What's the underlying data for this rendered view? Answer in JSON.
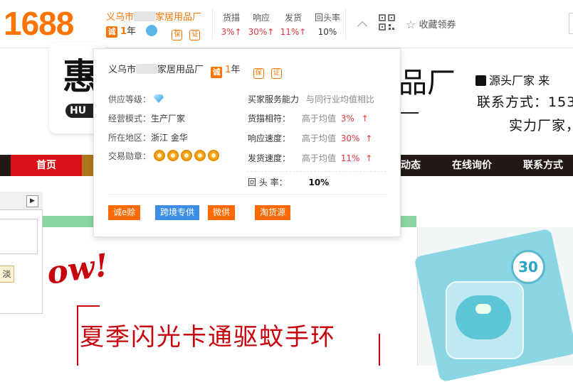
{
  "header": {
    "logo": "1688",
    "company_prefix": "义乌市",
    "company_suffix": "家居用品厂",
    "cheng_badge": "诚",
    "years": "1",
    "years_unit": "年",
    "metrics": [
      {
        "label": "货描",
        "value": "3%↑"
      },
      {
        "label": "响应",
        "value": "30%↑"
      },
      {
        "label": "发货",
        "value": "11%↑"
      },
      {
        "label": "回头率",
        "value": "10%"
      }
    ],
    "favorite_label": "收藏领券"
  },
  "banner": {
    "sign_char": "惠",
    "sign_pill": "HU",
    "sign_right": "品厂",
    "features": "源头厂家  来",
    "contact": "联系方式：153",
    "tagline": "实力厂家，"
  },
  "nav": {
    "home": "首页",
    "items": [
      "动态",
      "在线询价",
      "联系方式"
    ]
  },
  "content": {
    "wow_text": "ow!",
    "product_title": "夏季闪光卡通驱蚊手环",
    "badge_number": "30",
    "side_button": "淡"
  },
  "popup": {
    "company_prefix": "义乌市",
    "company_suffix": "家居用品厂",
    "cheng_badge": "诚",
    "years": "1",
    "years_unit": "年",
    "left": [
      {
        "label": "供应等级：",
        "value": ""
      },
      {
        "label": "经营模式：",
        "value": "生产厂家"
      },
      {
        "label": "所在地区：",
        "value": "浙江 金华"
      },
      {
        "label": "交易勋章：",
        "value": ""
      }
    ],
    "service_title": "买家服务能力",
    "service_compare": "与同行业均值相比",
    "services": [
      {
        "label": "货描相符：",
        "text": "高于均值",
        "value": "3%",
        "arrow": "↑"
      },
      {
        "label": "响应速度：",
        "text": "高于均值",
        "value": "30%",
        "arrow": "↑"
      },
      {
        "label": "发货速度：",
        "text": "高于均值",
        "value": "11%",
        "arrow": "↑"
      }
    ],
    "return_label": "回 头 率：",
    "return_value": "10%",
    "tags": [
      "诚e赊",
      "跨境专供",
      "微供",
      "淘货源"
    ]
  },
  "colors": {
    "brand_orange": "#ff7300",
    "up_red": "#e4393c",
    "nav_bg": "#231916",
    "nav_home_red": "#d8111a",
    "tag_blue": "#3b8de6"
  }
}
